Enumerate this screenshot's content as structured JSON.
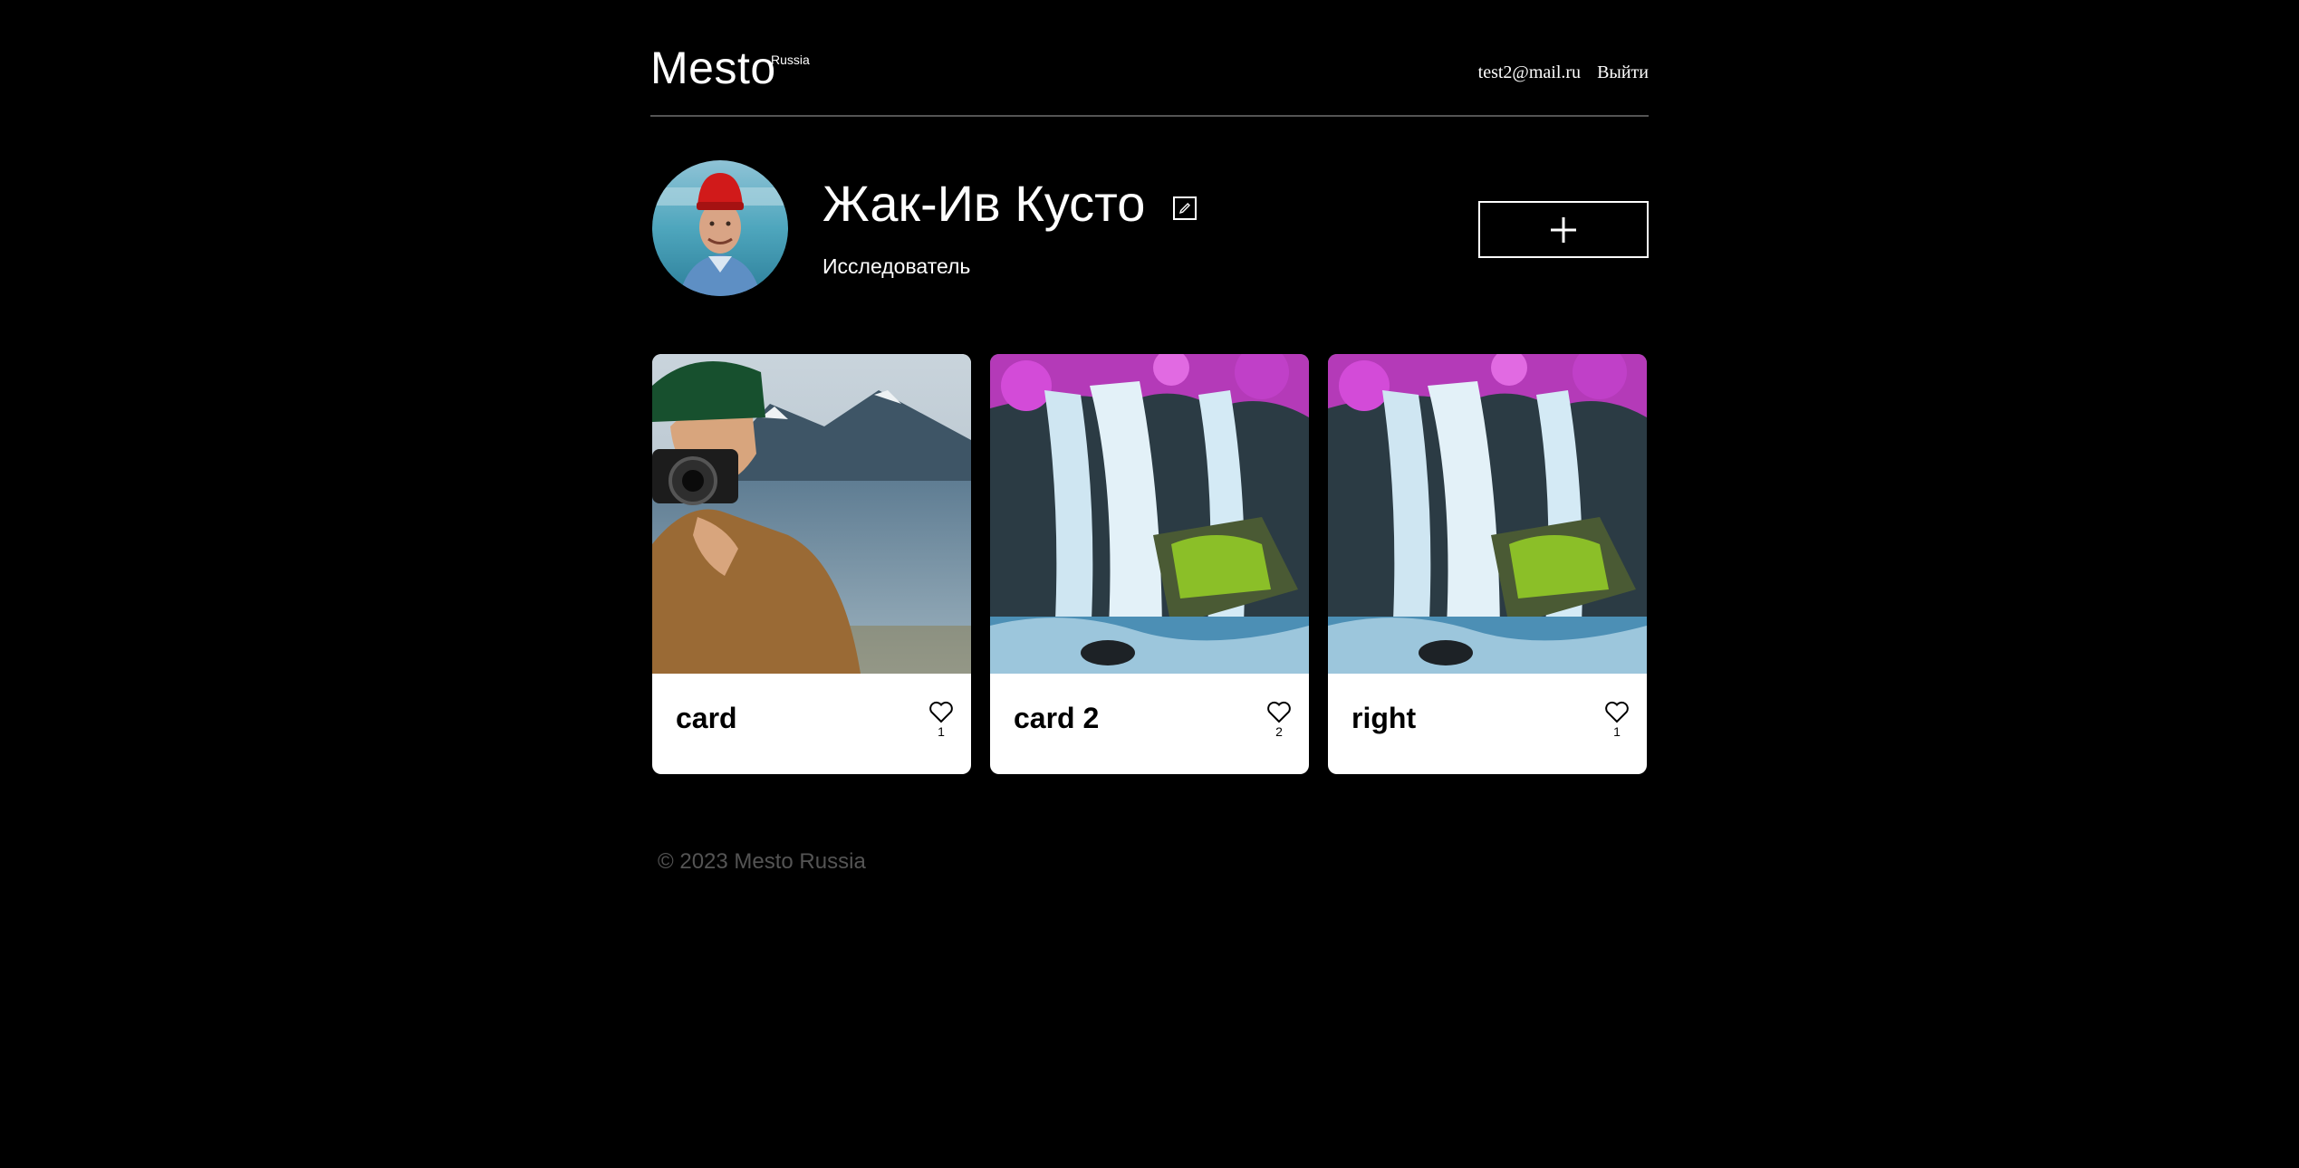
{
  "header": {
    "logo": "Mesto",
    "logo_sub": "Russia",
    "email": "test2@mail.ru",
    "logout": "Выйти"
  },
  "profile": {
    "name": "Жак-Ив Кусто",
    "about": "Исследователь",
    "edit_icon": "pencil-icon",
    "add_icon": "plus-icon"
  },
  "cards": [
    {
      "title": "card",
      "likes": "1"
    },
    {
      "title": "card 2",
      "likes": "2"
    },
    {
      "title": "right",
      "likes": "1"
    }
  ],
  "footer": {
    "copyright": "© 2023 Mesto Russia"
  },
  "colors": {
    "background": "#000000",
    "card": "#ffffff",
    "footer_text": "#545454",
    "divider": "#545454"
  }
}
